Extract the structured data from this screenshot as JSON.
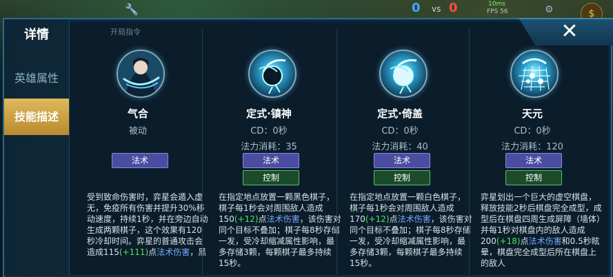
{
  "hud": {
    "score_blue": "0",
    "vs": "vs",
    "score_red": "0",
    "ping": "10ms",
    "fps": "FPS 56",
    "start_tip": "开局指令"
  },
  "sidebar": {
    "title": "详情",
    "items": [
      {
        "label": "英雄属性"
      },
      {
        "label": "技能描述"
      }
    ]
  },
  "close_label": "✕",
  "skills": [
    {
      "name": "气合",
      "sub1": "被动",
      "tags": [
        "法术"
      ],
      "desc_parts": [
        {
          "t": "受到致命伤害时，弈星会遁入虚无，免疫所有伤害并提升30%移动速度，持续1秒，并在旁边自动生成两颗棋子，这个效果有120秒冷却时间。弈星的普通攻击会造成115"
        },
        {
          "t": "(+111)",
          "c": "g"
        },
        {
          "t": "点"
        },
        {
          "t": "法术伤害",
          "c": "b"
        },
        {
          "t": "，黑"
        }
      ]
    },
    {
      "name": "定式·镇神",
      "sub1": "CD：0秒",
      "sub2": "法力消耗：35",
      "tags": [
        "法术",
        "控制"
      ],
      "desc_parts": [
        {
          "t": "在指定地点放置一颗黑色棋子，棋子每1秒会对周围敌人造成150"
        },
        {
          "t": "(+12)",
          "c": "g"
        },
        {
          "t": "点"
        },
        {
          "t": "法术伤害",
          "c": "b"
        },
        {
          "t": "，该伤害对同个目标不叠加；棋子每8秒存储一发，受冷却缩减属性影响，最多存储3颗，每颗棋子最多持续15秒。"
        }
      ]
    },
    {
      "name": "定式·倚盖",
      "sub1": "CD：0秒",
      "sub2": "法力消耗：40",
      "tags": [
        "法术",
        "控制"
      ],
      "desc_parts": [
        {
          "t": "在指定地点放置一颗白色棋子，棋子每1秒会对周围敌人造成170"
        },
        {
          "t": "(+12)",
          "c": "g"
        },
        {
          "t": "点"
        },
        {
          "t": "法术伤害",
          "c": "b"
        },
        {
          "t": "，该伤害对同个目标不叠加；棋子每8秒存储一发，受冷却缩减属性影响，最多存储3颗，每颗棋子最多持续15秒。"
        }
      ]
    },
    {
      "name": "天元",
      "sub1": "CD：0秒",
      "sub2": "法力消耗：120",
      "tags": [
        "法术",
        "控制"
      ],
      "desc_parts": [
        {
          "t": "弈星划出一个巨大的虚空棋盘，释放技能2秒后棋盘完全成型，成型后在棋盘四周生成屏障（墙体）并每1秒对棋盘内的敌人造成200"
        },
        {
          "t": "(+18)",
          "c": "g"
        },
        {
          "t": "点"
        },
        {
          "t": "法术伤害",
          "c": "b"
        },
        {
          "t": "和0.5秒眩晕，棋盘完全成型后所在棋盘上的敌人"
        }
      ]
    }
  ]
}
